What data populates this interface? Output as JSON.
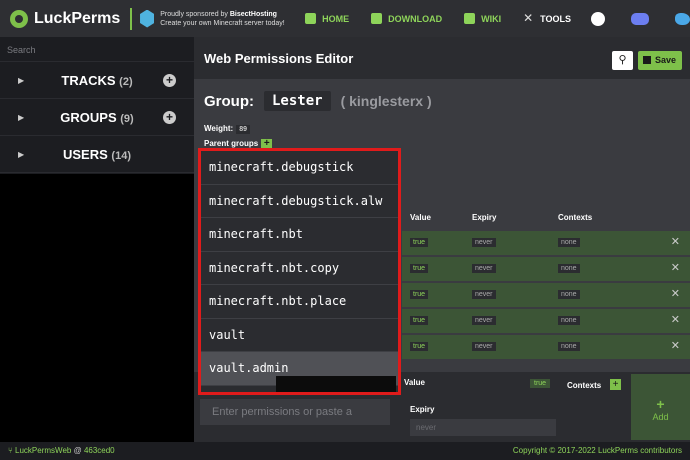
{
  "topbar": {
    "brand": "LuckPerms",
    "sponsor_line1_prefix": "Proudly sponsored by ",
    "sponsor_name": "BisectHosting",
    "sponsor_line2": "Create your own Minecraft server today!",
    "nav": [
      {
        "label": "HOME",
        "icon": "home-icon"
      },
      {
        "label": "DOWNLOAD",
        "icon": "download-icon"
      },
      {
        "label": "WIKI",
        "icon": "book-icon"
      },
      {
        "label": "TOOLS",
        "icon": "tools-icon"
      }
    ],
    "social_icons": [
      "github-icon",
      "discord-icon",
      "twitter-icon"
    ]
  },
  "sidebar": {
    "search_placeholder": "Search",
    "items": [
      {
        "label": "TRACKS",
        "count": "(2)"
      },
      {
        "label": "GROUPS",
        "count": "(9)"
      },
      {
        "label": "USERS",
        "count": "(14)"
      }
    ]
  },
  "editor": {
    "title": "Web Permissions Editor",
    "save_label": "Save",
    "group_label": "Group:",
    "group_name": "Lester",
    "group_display": "( kinglesterx )",
    "weight_label": "Weight:",
    "weight_value": "89",
    "parents_label": "Parent groups",
    "columns": {
      "value": "Value",
      "expiry": "Expiry",
      "contexts": "Contexts"
    },
    "rows": [
      {
        "value": "true",
        "expiry": "never",
        "contexts": "none"
      },
      {
        "value": "true",
        "expiry": "never",
        "contexts": "none"
      },
      {
        "value": "true",
        "expiry": "never",
        "contexts": "none"
      },
      {
        "value": "true",
        "expiry": "never",
        "contexts": "none"
      },
      {
        "value": "true",
        "expiry": "never",
        "contexts": "none"
      }
    ],
    "add": {
      "input_placeholder": "Enter permissions or paste a",
      "value_label": "Value",
      "value_default": "true",
      "expiry_label": "Expiry",
      "expiry_placeholder": "never",
      "contexts_label": "Contexts",
      "add_label": "Add"
    }
  },
  "dropdown": {
    "items": [
      "minecraft.debugstick",
      "minecraft.debugstick.alw",
      "minecraft.nbt",
      "minecraft.nbt.copy",
      "minecraft.nbt.place",
      "vault",
      "vault.admin"
    ],
    "active_index": 6
  },
  "footer": {
    "left_app": "LuckPermsWeb",
    "left_at": " @ ",
    "left_commit": "463ced0",
    "right": "Copyright © 2017-2022 LuckPerms contributors"
  }
}
